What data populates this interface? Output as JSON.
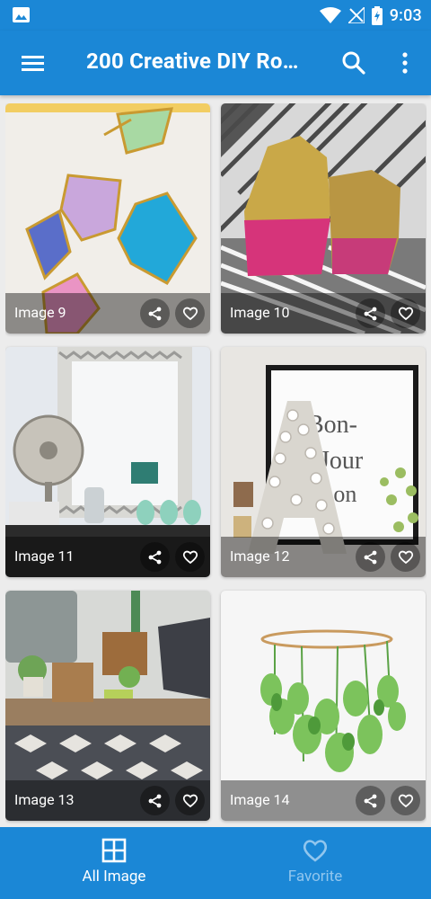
{
  "status_bar": {
    "time": "9:03",
    "icons": [
      "image-notification-icon",
      "wifi-icon",
      "no-signal-icon",
      "battery-charging-icon"
    ]
  },
  "app_bar": {
    "title": "200 Creative DIY Ro…",
    "icons": [
      "menu-icon",
      "search-icon",
      "more-vert-icon"
    ]
  },
  "images": [
    {
      "label": "Image 9",
      "subject": "geometric brass terrarium frames"
    },
    {
      "label": "Image 10",
      "subject": "gold and pink painted rocks"
    },
    {
      "label": "Image 11",
      "subject": "chevron mirror with fan and vases"
    },
    {
      "label": "Image 12",
      "subject": "marquee letter A and bonjour frame"
    },
    {
      "label": "Image 13",
      "subject": "living room with geometric rug"
    },
    {
      "label": "Image 14",
      "subject": "hanging hoop plant mobile"
    }
  ],
  "bottom_nav": {
    "all_label": "All Image",
    "fav_label": "Favorite",
    "active": "all"
  },
  "colors": {
    "primary": "#1b87d6",
    "nav_inactive": "#91c6ee",
    "overlay": "rgba(0,0,0,0.42)",
    "background": "#ececec"
  }
}
